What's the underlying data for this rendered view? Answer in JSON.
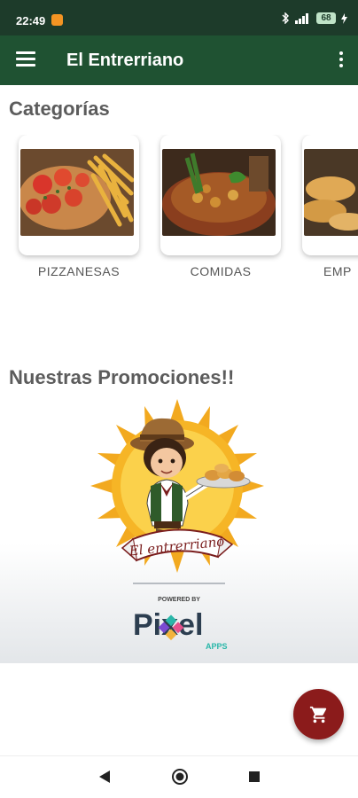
{
  "status": {
    "time": "22:49",
    "battery": "68",
    "notification_icon": "app-notification-icon",
    "icons": [
      "bluetooth-icon",
      "signal-icon",
      "battery-icon",
      "charging-icon"
    ]
  },
  "appbar": {
    "title": "El Entrerriano",
    "menu_icon": "hamburger-menu-icon",
    "more_icon": "more-vert-icon",
    "color": "#1f5232"
  },
  "categories": {
    "title": "Categorías",
    "items": [
      {
        "label": "PIZZANESAS",
        "image": "pizzanesa-photo"
      },
      {
        "label": "COMIDAS",
        "image": "stew-photo"
      },
      {
        "label": "EMP",
        "image": "empanadas-photo"
      }
    ]
  },
  "promotions": {
    "title": "Nuestras Promociones!!",
    "logo_text": "El entrerriano",
    "powered_by": "POWERED BY",
    "brand_name": "Pixel",
    "brand_sub": "APPS"
  },
  "fab": {
    "icon": "shopping-cart-icon",
    "color": "#8b1b1b"
  },
  "navbar": {
    "back": "back-icon",
    "home": "home-icon",
    "recents": "recents-icon"
  }
}
